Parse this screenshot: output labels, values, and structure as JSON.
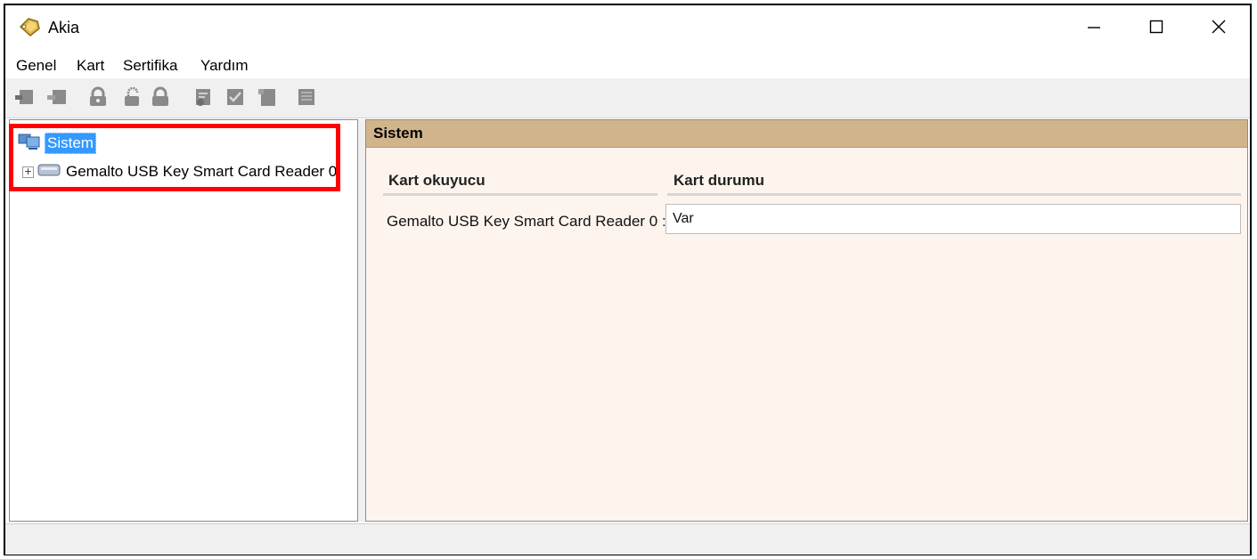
{
  "window": {
    "title": "Akia",
    "app_icon": "key-tag-icon",
    "controls": {
      "minimize": "minimize-icon",
      "maximize": "maximize-icon",
      "close": "close-icon"
    }
  },
  "menu": [
    "Genel",
    "Kart",
    "Sertifika",
    "Yardım"
  ],
  "toolbar": {
    "icons": [
      "card-insert-icon",
      "card-remove-icon",
      "lock-key-icon",
      "unlock-icon",
      "lock-icon",
      "certificate-sign-icon",
      "certificate-verify-icon",
      "card-icon",
      "report-icon"
    ],
    "enabled": false
  },
  "tree": {
    "root": {
      "label": "Sistem",
      "icon": "computer-icon",
      "selected": true
    },
    "children": [
      {
        "label": "Gemalto USB Key Smart Card Reader 0",
        "icon": "card-reader-icon",
        "expander": "+"
      }
    ]
  },
  "panel": {
    "header": "Sistem",
    "columns": [
      "Kart okuyucu",
      "Kart durumu"
    ],
    "rows": [
      {
        "reader": "Gemalto USB Key Smart Card Reader 0 :",
        "status": "Var"
      }
    ]
  },
  "colors": {
    "panel_header_bg": "#d2b48c",
    "panel_bg": "#fdf4ee",
    "selection": "#3399ff",
    "highlight_border": "#ff0000"
  }
}
